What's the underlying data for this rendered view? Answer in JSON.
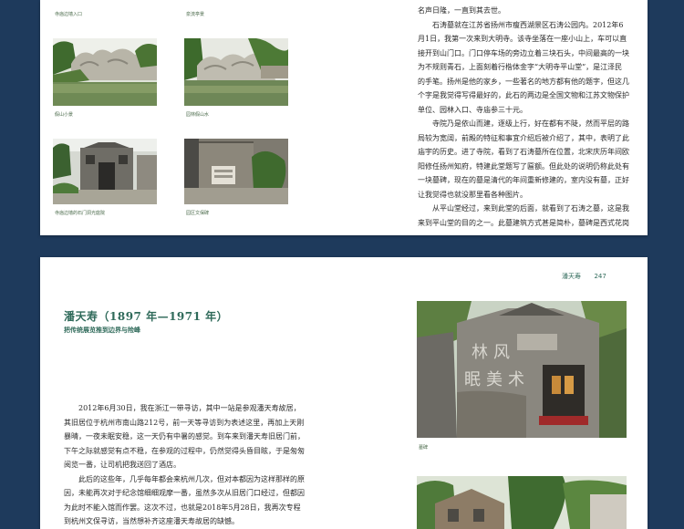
{
  "top_page": {
    "captions": {
      "c1": "寺庙边墙入口",
      "c2": "泉流亭景",
      "c3": "假山小景",
      "c4": "园林假山水",
      "c5": "寺庙边墙的石门洞光庭院",
      "c6": "园区文保碑"
    },
    "text": [
      "名声日隆，一直到其去世。",
      "石涛墓就在江苏省扬州市瘦西湖景区石涛公园内。2012年6月1日，我第一次来到大明寺。该寺坐落在一座小山上，车可以直接开到山门口。门口停车场的旁边立着三块石头，中间最高的一块为不规则青石，上面刻着行楷体金字“大明寺平山堂”，是江泽民的手笔。扬州是他的家乡，一些著名的地方都有他的题字，但这几个字是我觉得写得最好的，此石的两边是全国文物和江苏文物保护单位、园林入口、寺庙参三十元。",
      "寺院乃是依山而建，逐级上行，好在都有不陡，然而平层的路局较为宽阔，前殿的特征和事宜介绍后被介绍了，其中，表明了此庙宇的历史。进了寺院，看到了石涛墓所在位置，北宋庆历年间欧阳修任扬州知府，特建此堂题写了匾额。但此处的说明仍称此处有一块墓碑，现在的墓是清代的年间重新修建的，室内没有墓，正好让我觉得也就没那里看各种图片。",
      "从平山堂经过，来到此堂的后面，就看到了石涛之墓，这是我来到平山堂的目的之一。此墓建筑方式甚是简朴，墓碑是西式花岗岩。"
    ]
  },
  "bottom_page": {
    "header": {
      "name": "潘天寿",
      "page": "247"
    },
    "title": "潘天寿（1897 年—1971 年）",
    "subtitle": "把传统展览推到边界与险峰",
    "photo_caption": "墓碑",
    "text": [
      "2012年6月30日，我在浙江一带寻访，其中一站是参观潘天寿故居，其旧居位于杭州市南山路212号，前一天等寻访到为表述这里，再加上天刚暴晴，一夜未眠安稳，这一天仍有中暑的感觉。到车来到潘天寿旧居门前，下午之际就感觉有点不稳，在参观的过程中，仍然觉得头昏目眩，于是匆匆阅览一番，让司机把我送回了酒店。",
      "此后的这些年，几乎每年都会来杭州几次，但对本都因为这样那样的原因，未能再次对于纪念馆细细观摩一番，虽然多次从旧居门口经过，但都因为此时不能入馆而作罢。这次不过，也就是2018年5月28日，我再次专程到杭州文保寻访，当然想补齐这座潘天寿故居的缺憾。"
    ]
  }
}
